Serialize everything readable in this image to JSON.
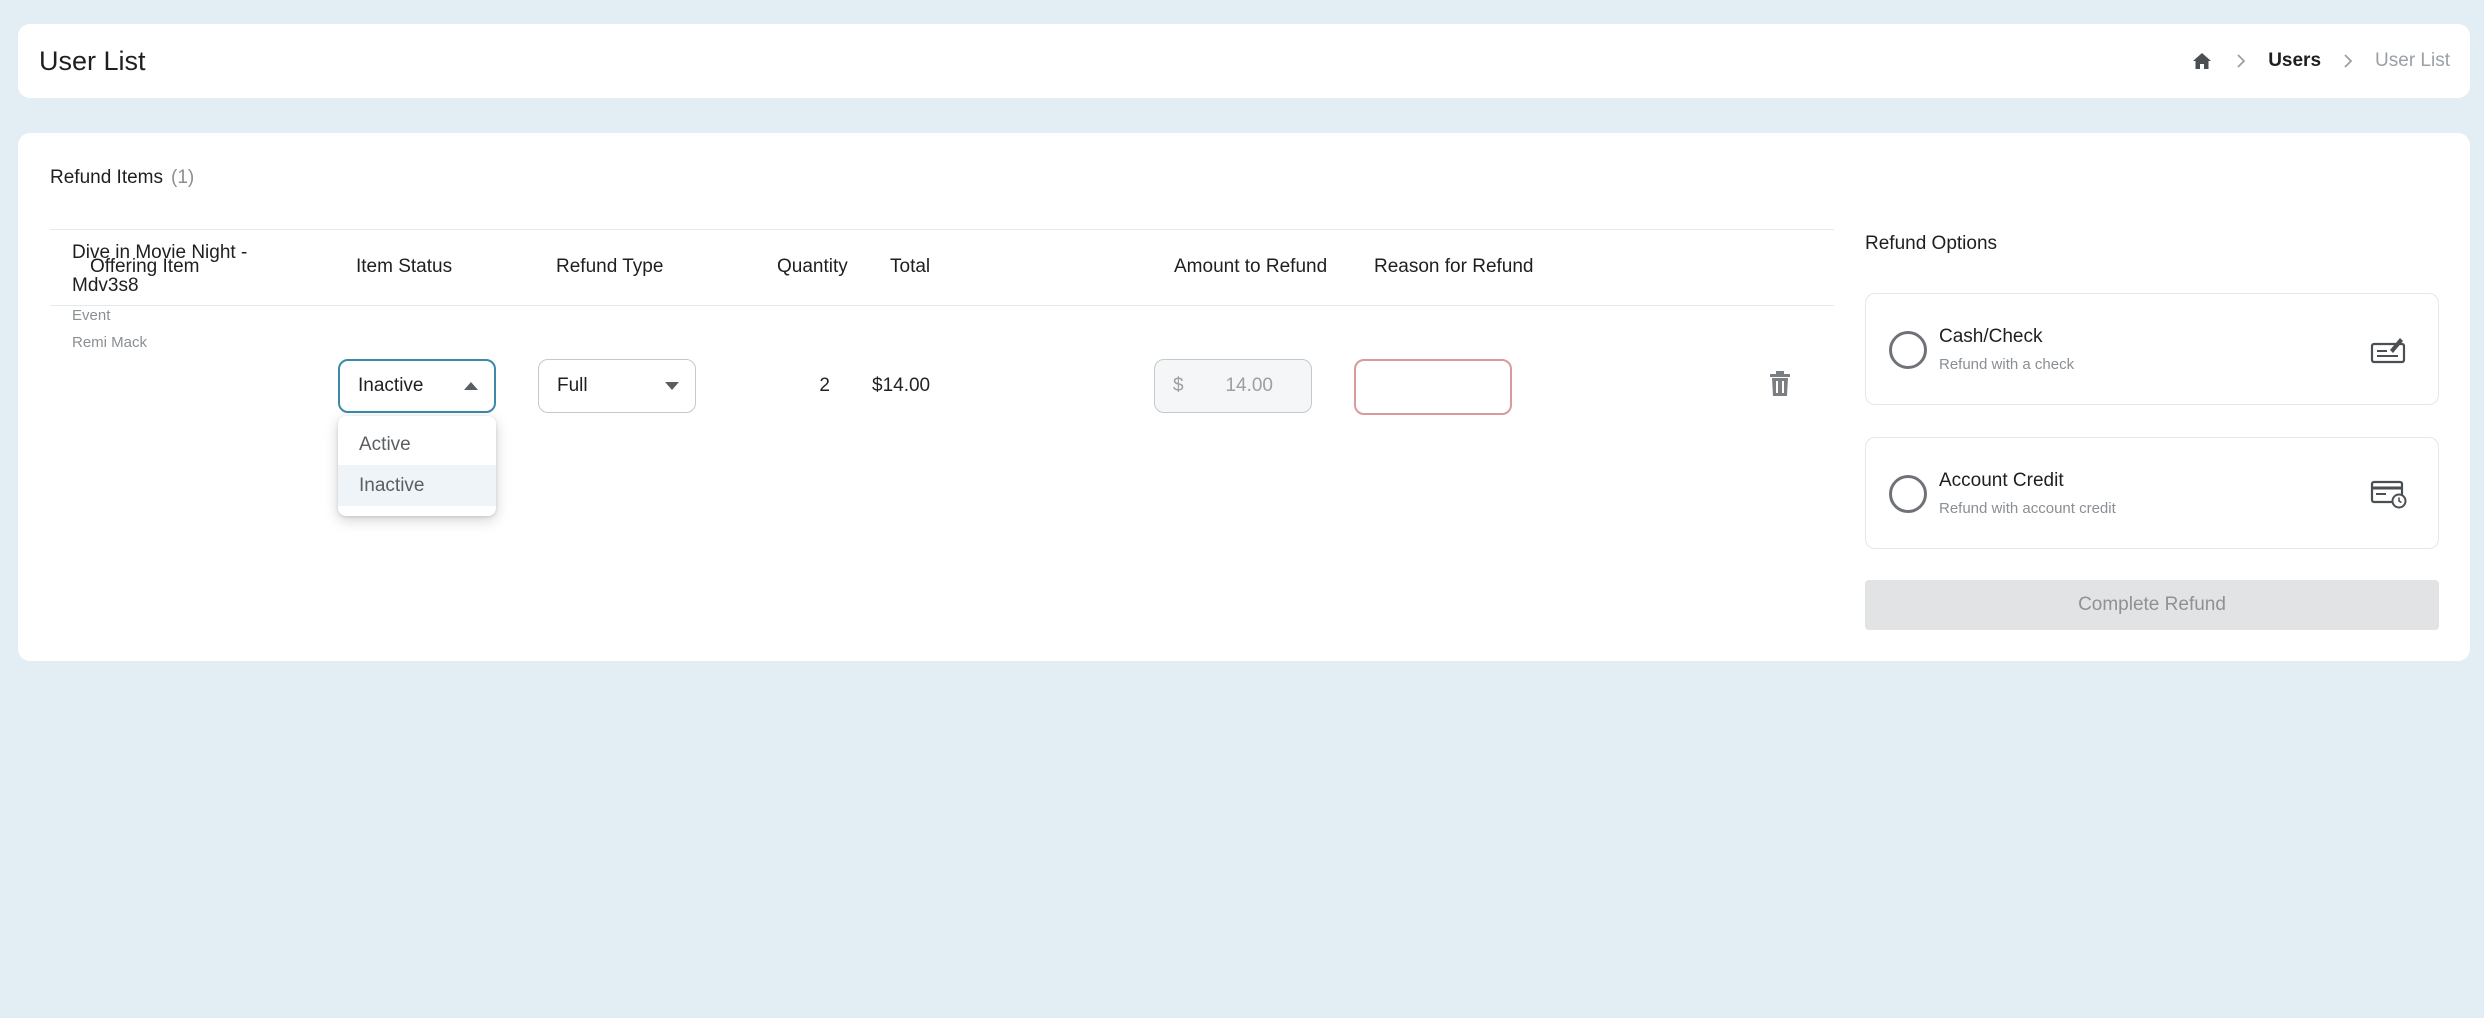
{
  "header": {
    "title": "User List",
    "breadcrumb": {
      "home_icon": "home-icon",
      "users": "Users",
      "current": "User List"
    }
  },
  "refund_items": {
    "title": "Refund Items",
    "count": "(1)",
    "columns": [
      "Offering Item",
      "Item Status",
      "Refund Type",
      "Quantity",
      "Total",
      "Amount to Refund",
      "Reason for Refund"
    ],
    "row": {
      "item_name": "Dive in Movie Night - Mdv3s8",
      "item_type": "Event",
      "item_owner": "Remi Mack",
      "status": "Inactive",
      "status_options": [
        "Active",
        "Inactive"
      ],
      "status_selected_option": "Inactive",
      "refund_type": "Full",
      "quantity": "2",
      "total": "$14.00",
      "currency_symbol": "$",
      "amount_to_refund": "14.00",
      "reason": ""
    }
  },
  "refund_options": {
    "title": "Refund Options",
    "options": [
      {
        "title": "Cash/Check",
        "description": "Refund with a check",
        "icon": "check-payment-icon"
      },
      {
        "title": "Account Credit",
        "description": "Refund with account credit",
        "icon": "account-credit-icon"
      }
    ],
    "complete_label": "Complete Refund"
  },
  "colors": {
    "background": "#e2eef3",
    "focus_border": "#3d8aa8",
    "error_border": "#d99a9a",
    "disabled_button": "#e2e3e4"
  }
}
